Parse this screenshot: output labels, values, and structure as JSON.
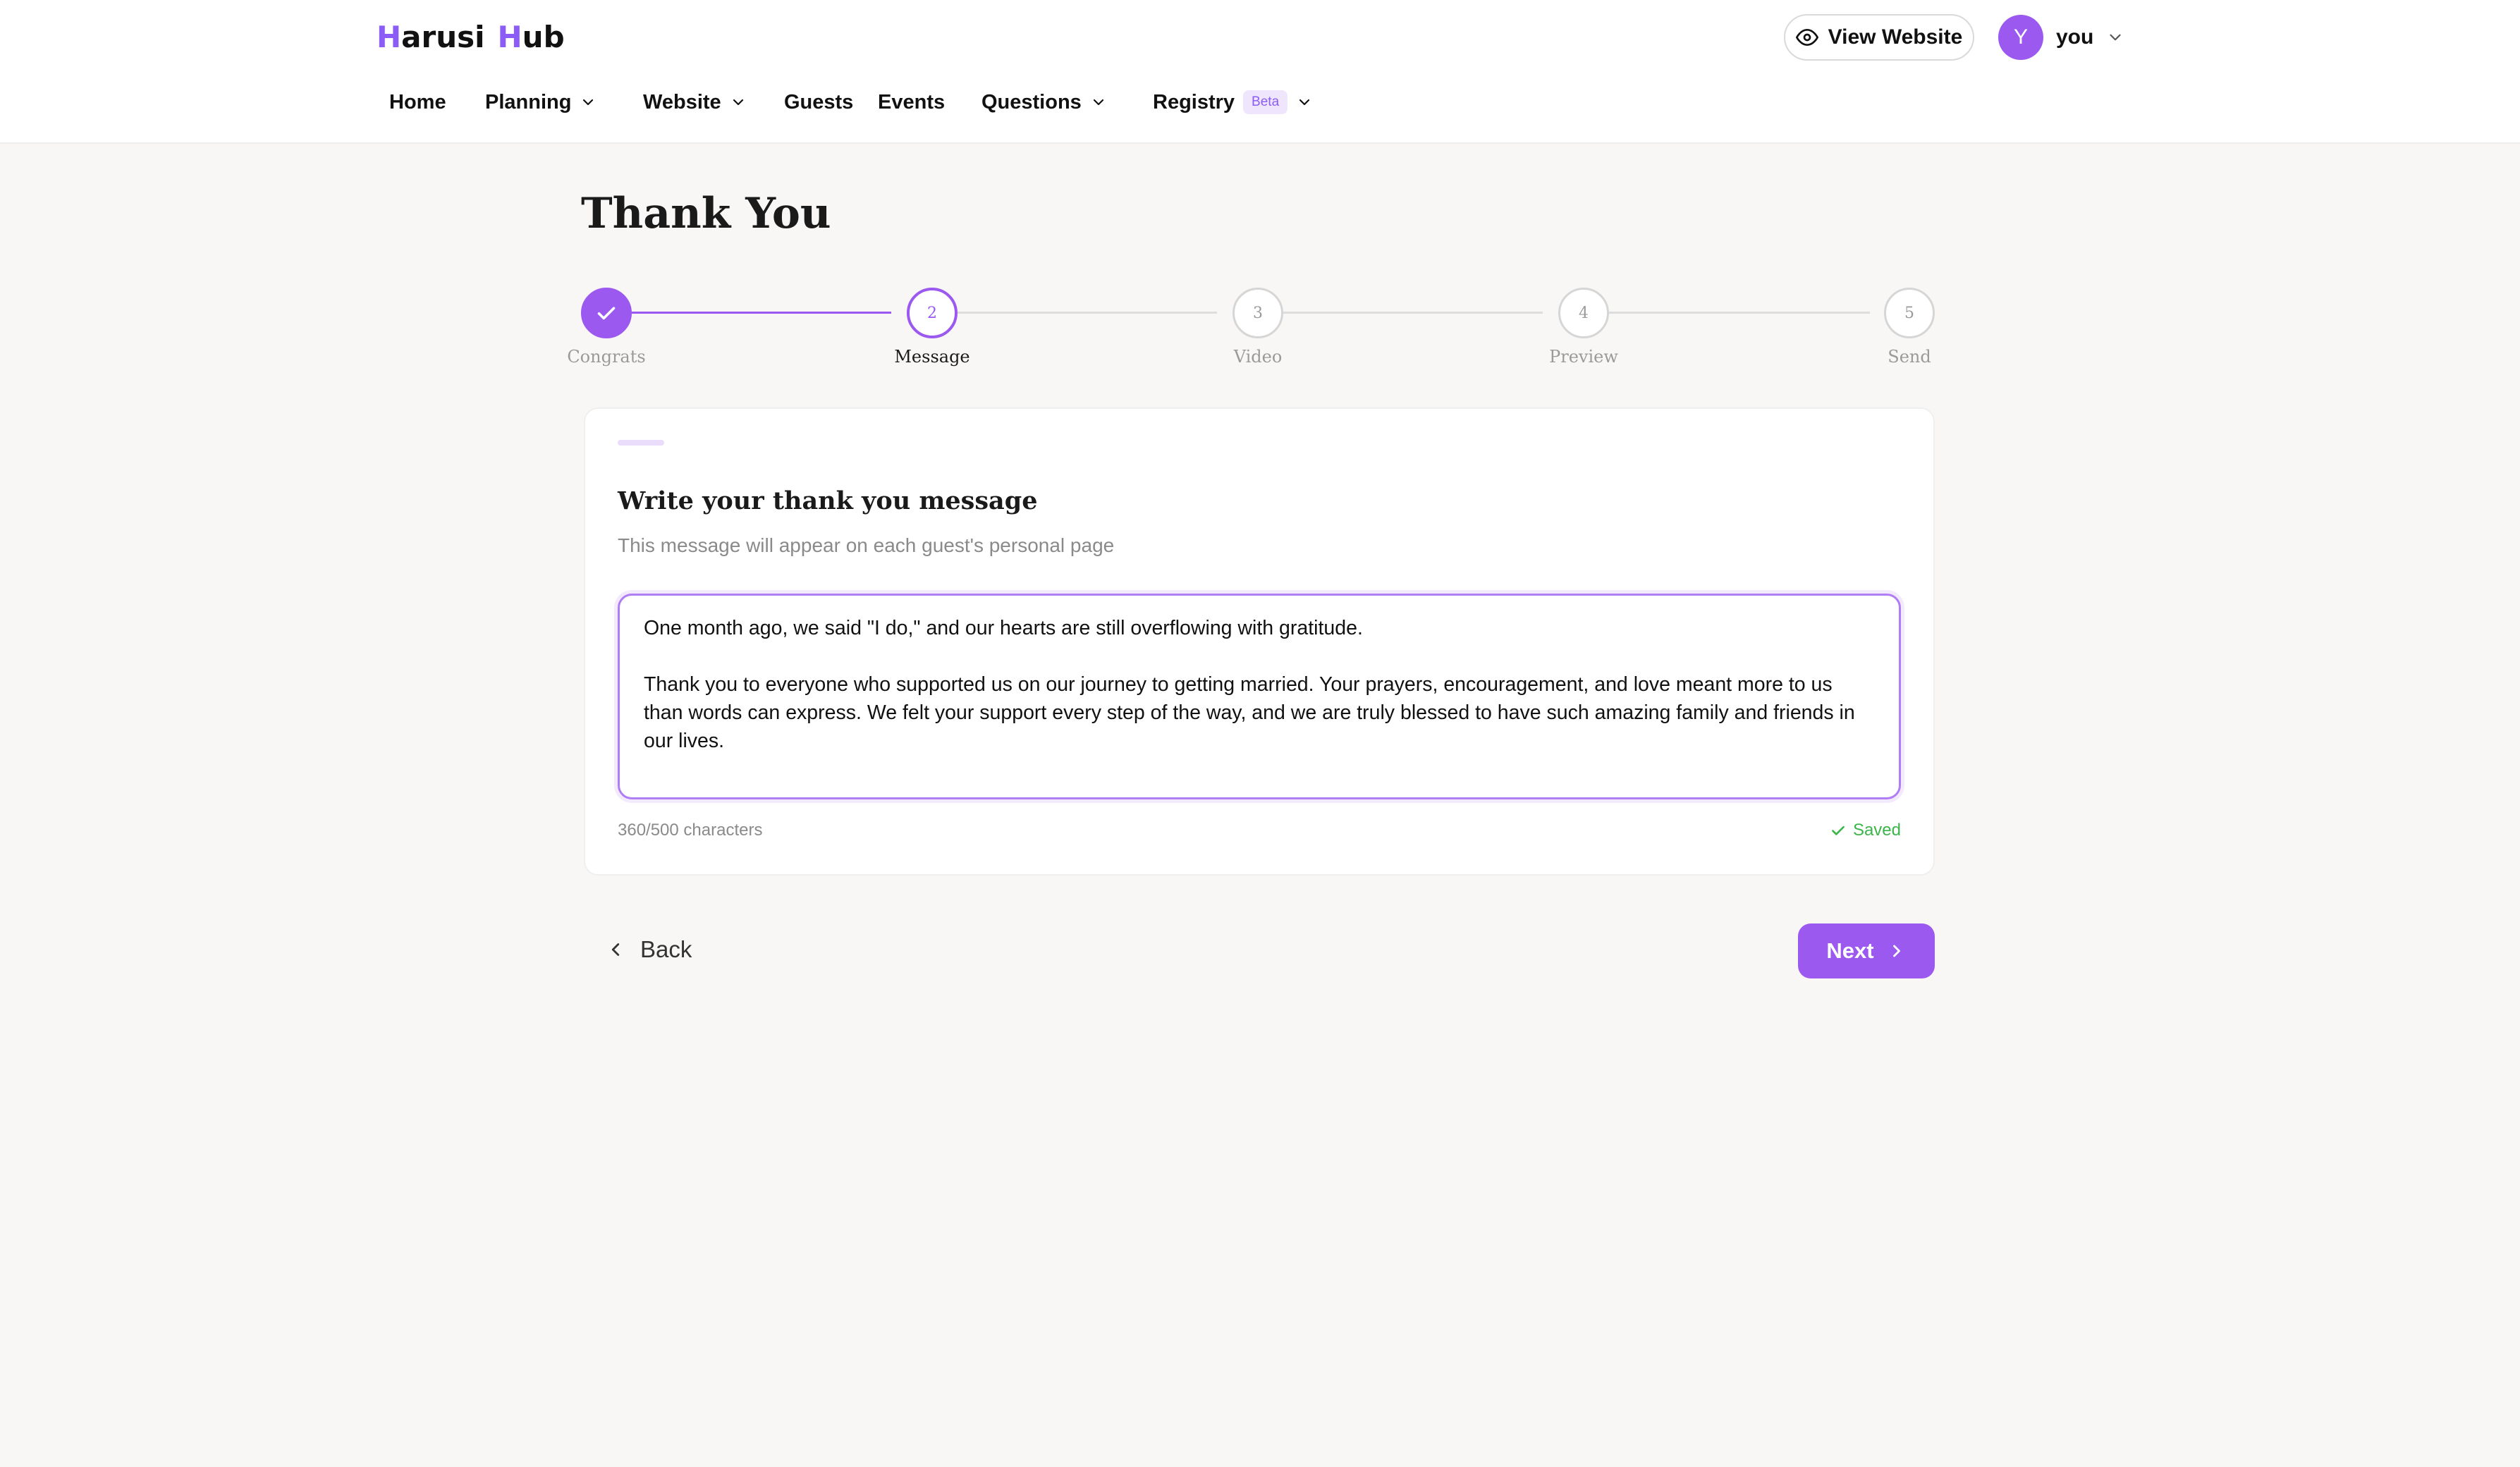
{
  "header": {
    "logo": {
      "part1_h": "H",
      "part1_rest": "arusi",
      "part2_h": "H",
      "part2_rest": "ub"
    },
    "view_website_label": "View Website",
    "user": {
      "initial": "Y",
      "name": "you"
    }
  },
  "nav": {
    "items": [
      {
        "label": "Home"
      },
      {
        "label": "Planning"
      },
      {
        "label": "Website"
      },
      {
        "label": "Guests"
      },
      {
        "label": "Events"
      },
      {
        "label": "Questions"
      },
      {
        "label": "Registry",
        "badge": "Beta"
      }
    ]
  },
  "page": {
    "title": "Thank You"
  },
  "stepper": {
    "steps": [
      {
        "number": "1",
        "label": "Congrats",
        "state": "done"
      },
      {
        "number": "2",
        "label": "Message",
        "state": "active"
      },
      {
        "number": "3",
        "label": "Video",
        "state": "pending"
      },
      {
        "number": "4",
        "label": "Preview",
        "state": "pending"
      },
      {
        "number": "5",
        "label": "Send",
        "state": "pending"
      }
    ]
  },
  "card": {
    "title": "Write your thank you message",
    "subtitle": "This message will appear on each guest's personal page",
    "message": "One month ago, we said \"I do,\" and our hearts are still overflowing with gratitude.\n\nThank you to everyone who supported us on our journey to getting married. Your prayers, encouragement, and love meant more to us than words can express. We felt your support every step of the way, and we are truly blessed to have such amazing family and friends in our lives.",
    "char_count": "360/500 characters",
    "saved_label": "Saved"
  },
  "footer": {
    "back_label": "Back",
    "next_label": "Next"
  },
  "colors": {
    "accent": "#9b59f0",
    "saved": "#3bb54a",
    "background": "#f8f7f6"
  }
}
